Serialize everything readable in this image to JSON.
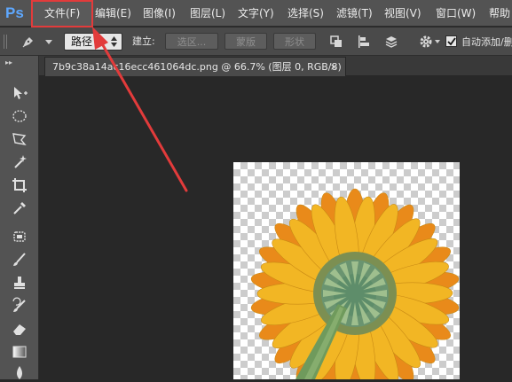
{
  "app": {
    "logo": "Ps"
  },
  "menu": [
    {
      "label": "文件(F)"
    },
    {
      "label": "编辑(E)"
    },
    {
      "label": "图像(I)"
    },
    {
      "label": "图层(L)"
    },
    {
      "label": "文字(Y)"
    },
    {
      "label": "选择(S)"
    },
    {
      "label": "滤镜(T)"
    },
    {
      "label": "视图(V)"
    },
    {
      "label": "窗口(W)"
    },
    {
      "label": "帮助"
    }
  ],
  "options": {
    "mode_value": "路径",
    "make_label": "建立:",
    "selection_button": "选区...",
    "mask_button": "蒙版",
    "shape_button": "形状",
    "auto_add_label": "自动添加/删",
    "auto_add_checked": true
  },
  "document": {
    "tab_title": "7b9c38a14ac16ecc461064dc.png @ 66.7% (图层 0, RGB/8)",
    "close_glyph": "×"
  },
  "colors": {
    "annotation_red": "#e23b3b",
    "petal_yellow": "#f2b624",
    "petal_orange": "#e98a1a",
    "flower_center": "#5e8d6a",
    "stem": "#6f9a5c"
  }
}
